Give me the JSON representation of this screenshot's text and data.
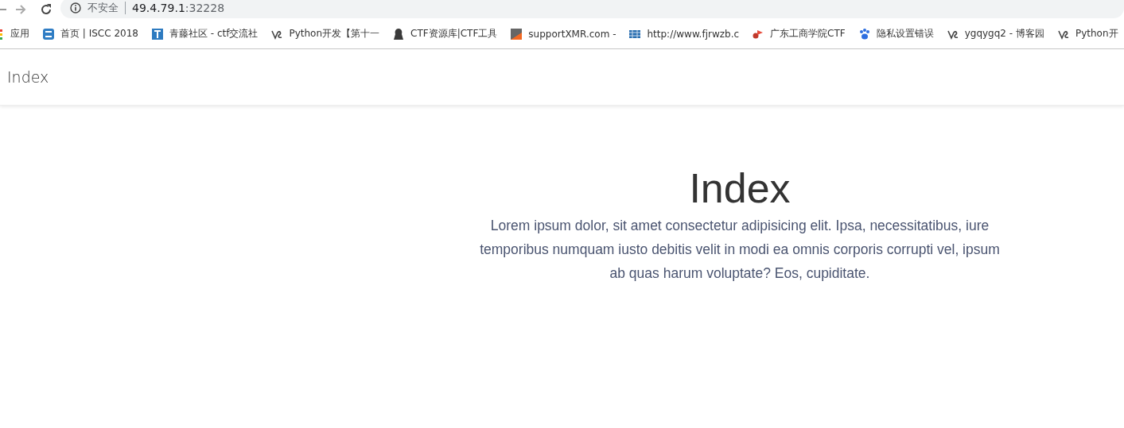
{
  "browser": {
    "security_label": "不安全",
    "url_host": "49.4.79.1",
    "url_port": ":32228",
    "bookmarks": [
      {
        "kind": "apps",
        "label": "应用"
      },
      {
        "kind": "blue-s",
        "label": "首页 | ISCC 2018"
      },
      {
        "kind": "blue-t",
        "label": "青藤社区 - ctf交流社"
      },
      {
        "kind": "swirl",
        "label": "Python开发【第十一"
      },
      {
        "kind": "hacker",
        "label": "CTF资源库|CTF工具"
      },
      {
        "kind": "slash",
        "label": "supportXMR.com -"
      },
      {
        "kind": "grid",
        "label": "http://www.fjrwzb.c"
      },
      {
        "kind": "flag",
        "label": "广东工商学院CTF"
      },
      {
        "kind": "paw",
        "label": "隐私设置错误"
      },
      {
        "kind": "swirl",
        "label": "ygqygq2 - 博客园"
      },
      {
        "kind": "swirl",
        "label": "Python开"
      }
    ]
  },
  "navbar": {
    "brand": "Index"
  },
  "main": {
    "heading": "Index",
    "text": "Lorem ipsum dolor, sit amet consectetur adipisicing elit. Ipsa, necessitatibus, iure temporibus numquam iusto debitis velit in modi ea omnis corporis corrupti vel, ipsum ab quas harum voluptate? Eos, cupiditate."
  }
}
